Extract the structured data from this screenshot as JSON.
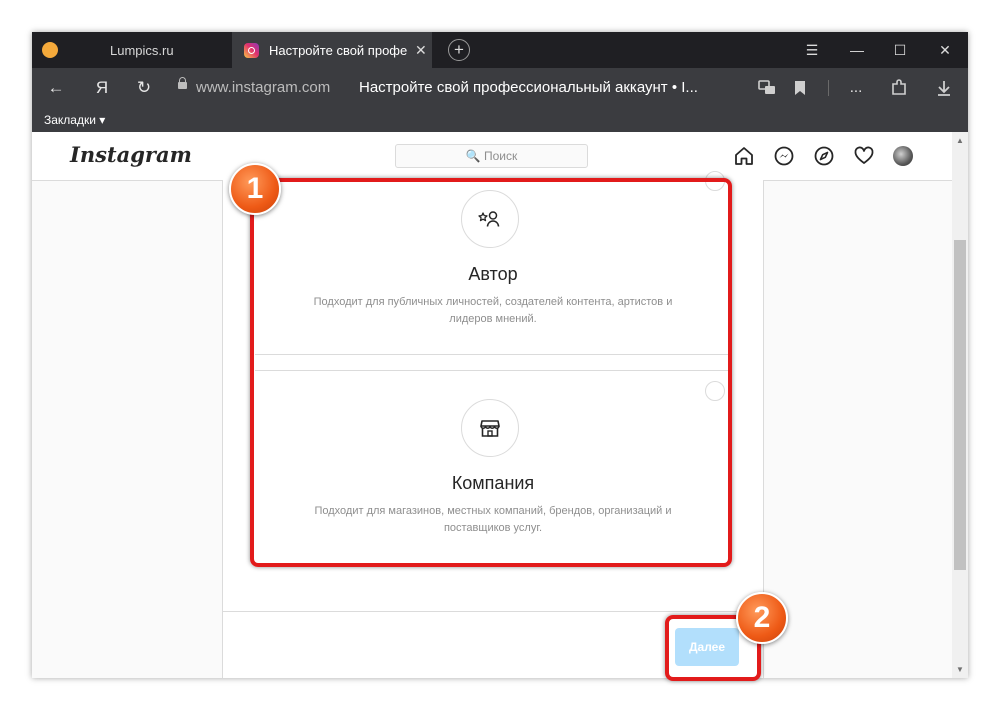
{
  "browser": {
    "tabs": [
      {
        "label": "Lumpics.ru",
        "favicon": "orange-circle-icon"
      },
      {
        "label": "Настройте свой профе",
        "favicon": "instagram-icon",
        "close": "✕"
      }
    ],
    "new_tab": "+",
    "window_controls": {
      "menu": "☰",
      "minimize": "—",
      "maximize": "☐",
      "close": "✕"
    },
    "nav": {
      "back": "←",
      "yandex": "Я",
      "reload": "↻"
    },
    "url_domain": "www.instagram.com",
    "page_title": "Настройте свой профессиональный аккаунт • I...",
    "bookmarks_label": "Закладки ▾",
    "extras": {
      "more": "..."
    }
  },
  "instagram": {
    "logo": "Instagram",
    "search_placeholder": "🔍 Поиск",
    "options": [
      {
        "title": "Автор",
        "description": "Подходит для публичных личностей, создателей контента, артистов и лидеров мнений.",
        "icon": "star-person-icon",
        "selected": false
      },
      {
        "title": "Компания",
        "description": "Подходит для магазинов, местных компаний, брендов, организаций и поставщиков услуг.",
        "icon": "storefront-icon",
        "selected": false
      }
    ],
    "next_button": "Далее"
  },
  "annotations": {
    "badge1": "1",
    "badge2": "2",
    "highlight_color": "#e21b1b",
    "badge_color": "#ee5a16"
  }
}
